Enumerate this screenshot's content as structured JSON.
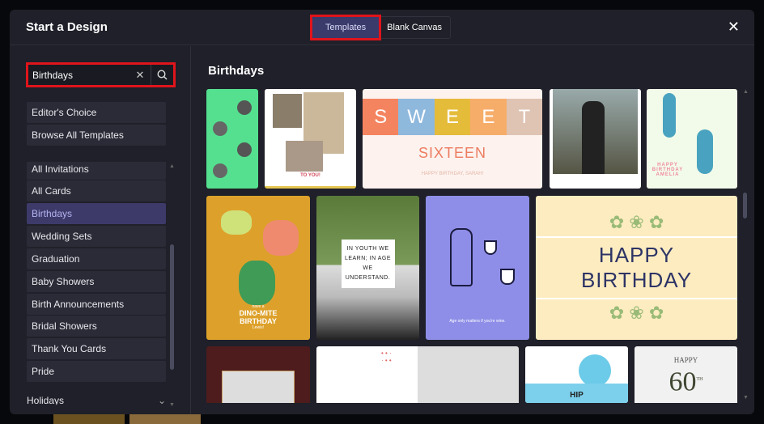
{
  "dialog": {
    "title": "Start a Design",
    "close_icon": "close-icon"
  },
  "tabs": [
    {
      "label": "Templates",
      "active": true
    },
    {
      "label": "Blank Canvas",
      "active": false
    }
  ],
  "search": {
    "value": "Birthdays",
    "clear_icon": "x",
    "search_icon": "magnifier"
  },
  "sidebar": {
    "top_items": [
      "Editor's Choice",
      "Browse All Templates"
    ],
    "items": [
      "All Invitations",
      "All Cards",
      "Birthdays",
      "Wedding Sets",
      "Graduation",
      "Baby Showers",
      "Birth Announcements",
      "Bridal Showers",
      "Thank You Cards",
      "Pride"
    ],
    "selected": "Birthdays",
    "section": "Holidays"
  },
  "main": {
    "title": "Birthdays"
  },
  "templates": {
    "t2": "TO YOU!",
    "t3a": "SWEET",
    "t3b": "SIXTEEN",
    "t3c": "HAPPY BIRTHDAY, SARAH!",
    "t5": "HAPPY BIRTHDAY AMELIA",
    "t6a": "have a",
    "t6b": "DINO-MITE BIRTHDAY",
    "t6c": "Lewis!",
    "t7": "IN YOUTH WE LEARN; IN AGE WE UNDERSTAND.",
    "t8": "Age only matters if you're wine.",
    "t9": "HAPPY BIRTHDAY",
    "t12": "HIP",
    "t13a": "HAPPY",
    "t13b": "60",
    "t13c": "TH"
  },
  "colors": {
    "accent": "#3d3a6a",
    "highlight": "#e0141b",
    "bg": "#1f2029"
  }
}
